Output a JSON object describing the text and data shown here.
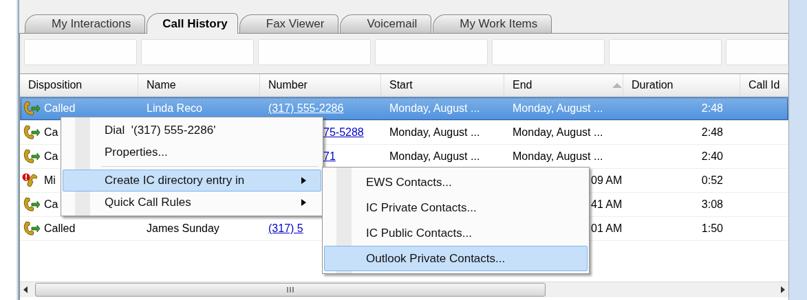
{
  "tabs": [
    {
      "label": "My Interactions",
      "selected": false
    },
    {
      "label": "Call History",
      "selected": true
    },
    {
      "label": "Fax Viewer",
      "selected": false
    },
    {
      "label": "Voicemail",
      "selected": false
    },
    {
      "label": "My Work Items",
      "selected": false
    }
  ],
  "table": {
    "columns": [
      {
        "label": "Disposition"
      },
      {
        "label": "Name"
      },
      {
        "label": "Number"
      },
      {
        "label": "Start"
      },
      {
        "label": "End",
        "sorted": true
      },
      {
        "label": "Duration"
      },
      {
        "label": "Call Id"
      }
    ],
    "rows": [
      {
        "selected": true,
        "disposition": {
          "kind": "called",
          "text": "Called"
        },
        "name": "Linda Reco",
        "number": "(317) 555-2286",
        "start": "Monday, August ...",
        "end": "Monday, August ...",
        "duration": "2:48"
      },
      {
        "selected": false,
        "disposition": {
          "kind": "called",
          "text": "Ca"
        },
        "number": "75-5288",
        "start": "Monday, August ...",
        "end": "Monday, August ...",
        "duration": "2:48"
      },
      {
        "selected": false,
        "disposition": {
          "kind": "called",
          "text": "Ca"
        },
        "number": "71",
        "start": "Monday, August ...",
        "end": "Monday, August ...",
        "duration": "2:40"
      },
      {
        "selected": false,
        "disposition": {
          "kind": "missed",
          "text": "Mi"
        },
        "end": "09 AM",
        "duration": "0:52"
      },
      {
        "selected": false,
        "disposition": {
          "kind": "called",
          "text": "Ca"
        },
        "end": "41 AM",
        "duration": "3:08"
      },
      {
        "selected": false,
        "disposition": {
          "kind": "called",
          "text": "Called"
        },
        "name": "James Sunday",
        "number": "(317) 5",
        "end": "01 AM",
        "duration": "1:50"
      }
    ]
  },
  "context_menu": {
    "items": [
      {
        "kind": "item",
        "label": "Dial  '(317) 555-2286'",
        "submenu": false,
        "selected": false
      },
      {
        "kind": "item",
        "label": "Properties...",
        "submenu": false,
        "selected": false
      },
      {
        "kind": "separator"
      },
      {
        "kind": "item",
        "label": "Create IC directory entry in",
        "submenu": true,
        "selected": true
      },
      {
        "kind": "item",
        "label": "Quick Call Rules",
        "submenu": true,
        "selected": false
      }
    ]
  },
  "submenu": {
    "items": [
      {
        "label": "EWS Contacts...",
        "selected": false
      },
      {
        "label": "IC Private Contacts...",
        "selected": false
      },
      {
        "label": "IC Public Contacts...",
        "selected": false
      },
      {
        "label": "Outlook Private Contacts...",
        "selected": true
      }
    ]
  }
}
